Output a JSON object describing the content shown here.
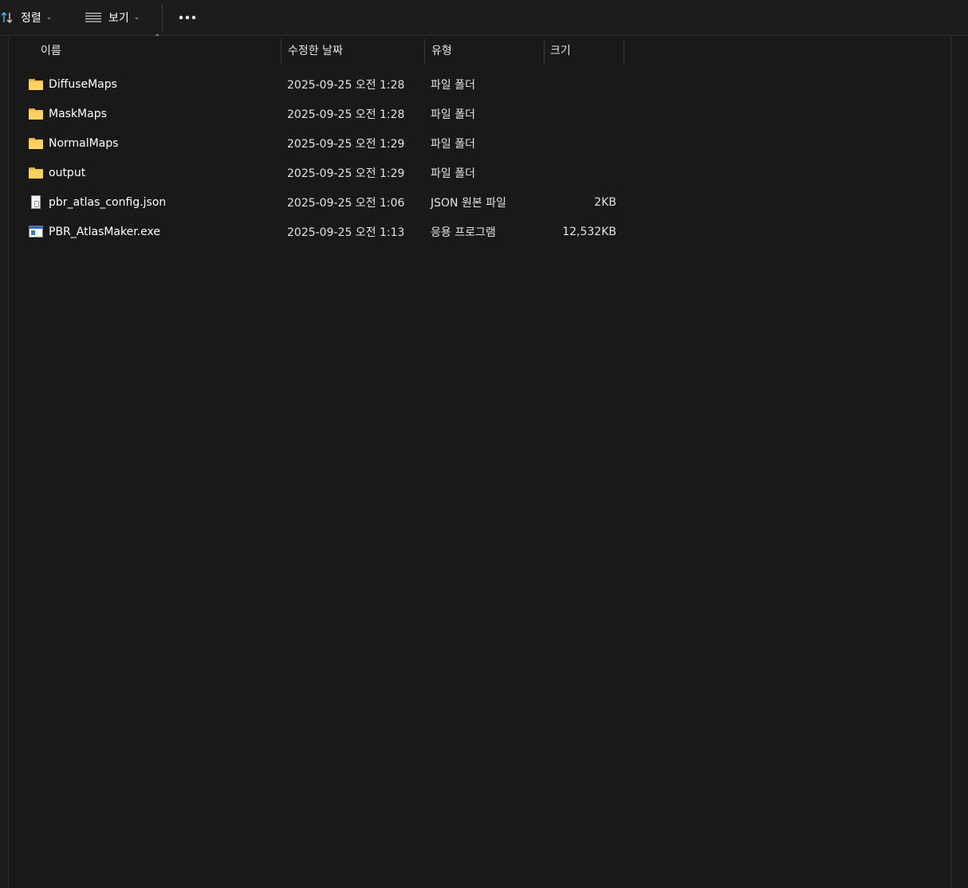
{
  "toolbar": {
    "sort_label": "정렬",
    "view_label": "보기",
    "more_label": "•••"
  },
  "columns": {
    "name": "이름",
    "date": "수정한 날짜",
    "type": "유형",
    "size": "크기"
  },
  "files": [
    {
      "name": "DiffuseMaps",
      "date": "2025-09-25 오전 1:28",
      "type": "파일 폴더",
      "size": "",
      "icon": "folder-icon"
    },
    {
      "name": "MaskMaps",
      "date": "2025-09-25 오전 1:28",
      "type": "파일 폴더",
      "size": "",
      "icon": "folder-icon"
    },
    {
      "name": "NormalMaps",
      "date": "2025-09-25 오전 1:29",
      "type": "파일 폴더",
      "size": "",
      "icon": "folder-icon"
    },
    {
      "name": "output",
      "date": "2025-09-25 오전 1:29",
      "type": "파일 폴더",
      "size": "",
      "icon": "folder-icon"
    },
    {
      "name": "pbr_atlas_config.json",
      "date": "2025-09-25 오전 1:06",
      "type": "JSON 원본 파일",
      "size": "2KB",
      "icon": "json-file-icon"
    },
    {
      "name": "PBR_AtlasMaker.exe",
      "date": "2025-09-25 오전 1:13",
      "type": "응용 프로그램",
      "size": "12,532KB",
      "icon": "exe-file-icon"
    }
  ]
}
